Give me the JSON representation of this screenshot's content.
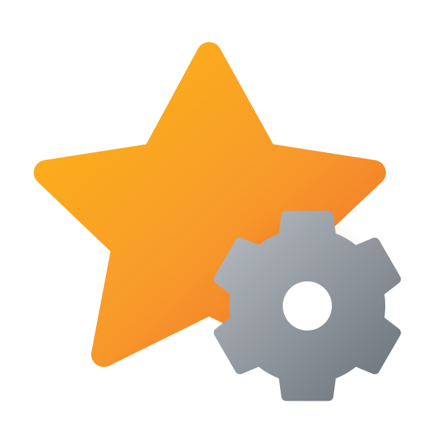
{
  "icon": {
    "description_name": "star-with-gear",
    "colors": {
      "background": "#ffffff",
      "star_light": "#FDB515",
      "star_mid": "#F89A2B",
      "star_dark": "#EF6A28",
      "gear_light": "#B7BCC2",
      "gear_dark": "#6A727A",
      "gear_hole": "#ffffff"
    }
  }
}
